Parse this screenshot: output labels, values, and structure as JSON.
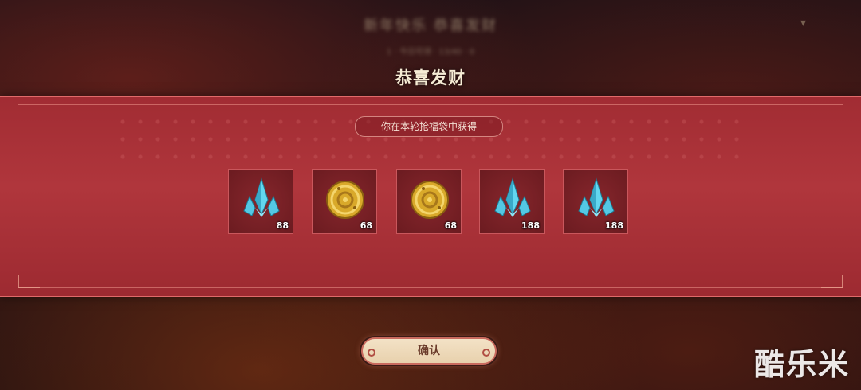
{
  "background": {
    "blurred_title": "新年快乐 恭喜发财",
    "blurred_subtitle": "1 · 今日可领 · 13/40 · 0"
  },
  "dialog": {
    "title": "恭喜发财",
    "subtitle": "你在本轮抢福袋中获得",
    "rewards": [
      {
        "icon": "crystal-icon",
        "quantity": "88"
      },
      {
        "icon": "gold-coin-icon",
        "quantity": "68"
      },
      {
        "icon": "gold-coin-icon",
        "quantity": "68"
      },
      {
        "icon": "crystal-icon",
        "quantity": "188"
      },
      {
        "icon": "crystal-icon",
        "quantity": "188"
      }
    ],
    "confirm_label": "确认"
  },
  "watermark": "酷乐米",
  "colors": {
    "panel": "#b0363c",
    "panel_border": "#e06a6a",
    "crystal": "#46c6e0",
    "coin": "#d9a92a",
    "button_face": "#f3e2c6"
  }
}
